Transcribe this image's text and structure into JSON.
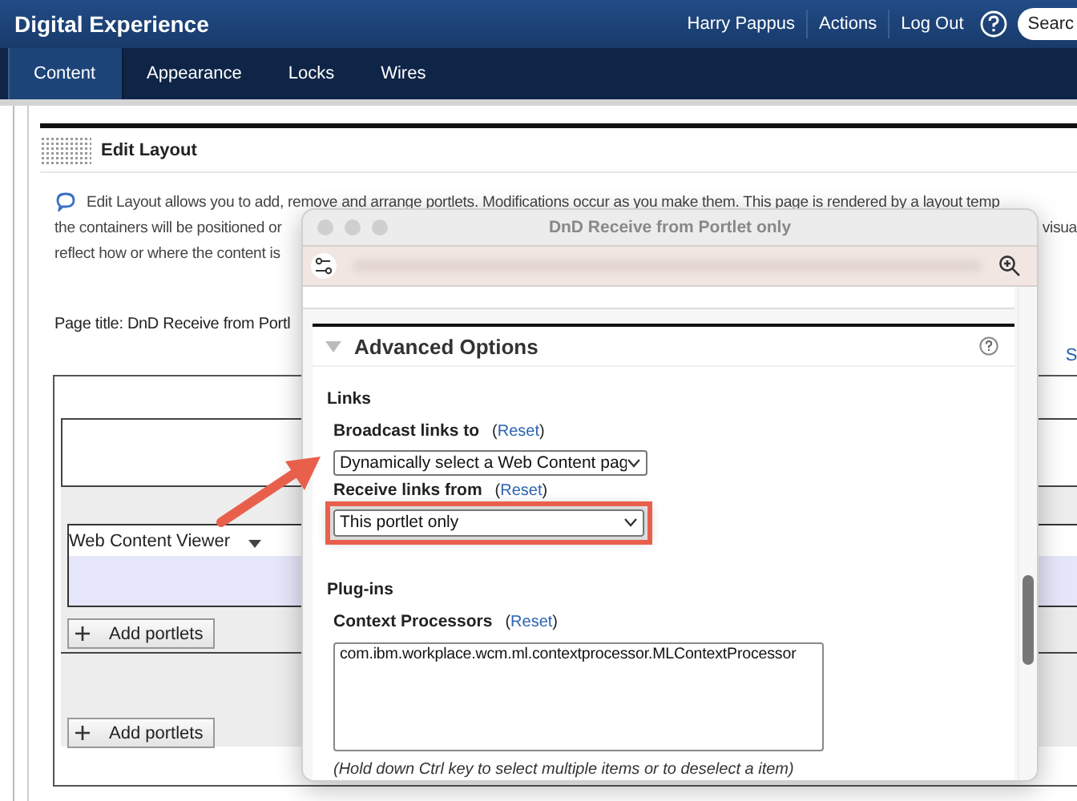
{
  "header": {
    "title": "Digital Experience",
    "user": "Harry Pappus",
    "links": [
      "Actions",
      "Log Out"
    ],
    "search_button": "Searc"
  },
  "tabs": [
    {
      "label": "Content",
      "selected": true
    },
    {
      "label": "Appearance",
      "selected": false
    },
    {
      "label": "Locks",
      "selected": false
    },
    {
      "label": "Wires",
      "selected": false
    }
  ],
  "edit_layout": {
    "title": "Edit Layout",
    "intro": [
      "Edit Layout allows you to add, remove and arrange portlets. Modifications occur as you make them. This page is rendered by a layout temp",
      "the containers will be positioned or",
      "reflect how or where the content is"
    ],
    "intro_right": "visua",
    "page_title": "Page title: DnD Receive from Portl",
    "side_link": "S",
    "portlet": "Web Content Viewer",
    "add_buttons": [
      "Add portlets",
      "Add portlets"
    ]
  },
  "dialog": {
    "title": "DnD Receive from Portlet only",
    "section": {
      "title": "Advanced Options",
      "expanded": true
    },
    "groups": [
      {
        "title": "Links",
        "fields": [
          {
            "kind": "select",
            "label": "Broadcast links to",
            "reset": [
              "(",
              "Reset",
              ")"
            ],
            "value": "Dynamically select a Web Content pag",
            "highlighted": false
          },
          {
            "kind": "select",
            "label": "Receive links from",
            "reset": [
              "(",
              "Reset",
              ")"
            ],
            "value": "This portlet only",
            "highlighted": true
          }
        ]
      },
      {
        "title": "Plug-ins",
        "fields": [
          {
            "kind": "list",
            "label": "Context Processors",
            "reset": [
              "(",
              "Reset",
              ")"
            ],
            "value": "com.ibm.workplace.wcm.ml.contextprocessor.MLContextProcessor",
            "highlighted": false,
            "hint": "(Hold down Ctrl key to select multiple items or to deselect a item)"
          }
        ]
      }
    ]
  },
  "callout_arrow": true
}
